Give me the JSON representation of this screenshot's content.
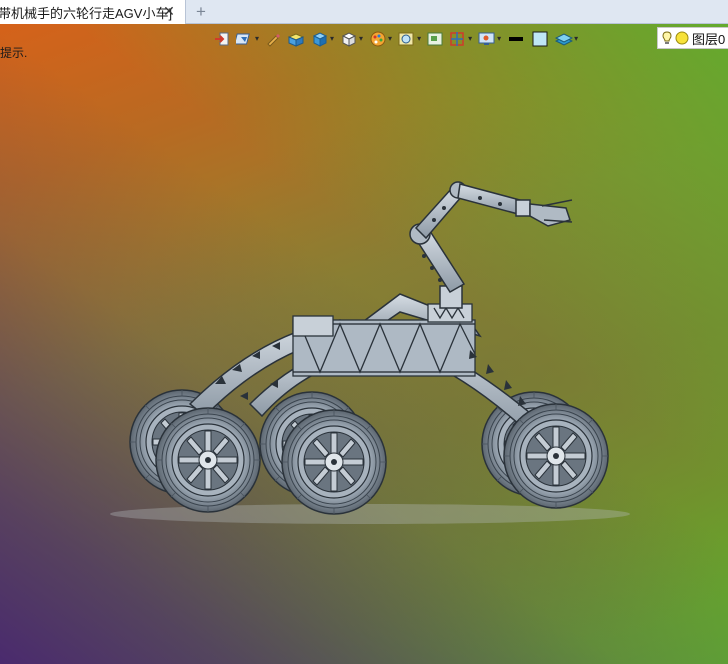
{
  "tabs": [
    {
      "label": "带机械手的六轮行走AGV小车]",
      "close": "✕"
    }
  ],
  "new_tab_label": "+",
  "viewport": {
    "hint_text": "提示."
  },
  "toolbar": {
    "icons": [
      "import-icon",
      "view-orient-icon",
      "pencil-icon",
      "render-shaded-icon",
      "cube-blue-icon",
      "cube-white-icon",
      "palette-icon",
      "zoom-view-icon",
      "fit-view-icon",
      "section-icon",
      "display-settings-icon",
      "line-weight-icon",
      "color-square-icon",
      "layers-stack-icon"
    ],
    "layer_label": "图层0"
  },
  "colors": {
    "tab_bg": "#ffffff",
    "tabbar_bg": "#dfe7f2",
    "model_metal": "#b8c2cc",
    "model_edge": "#2a323a"
  }
}
